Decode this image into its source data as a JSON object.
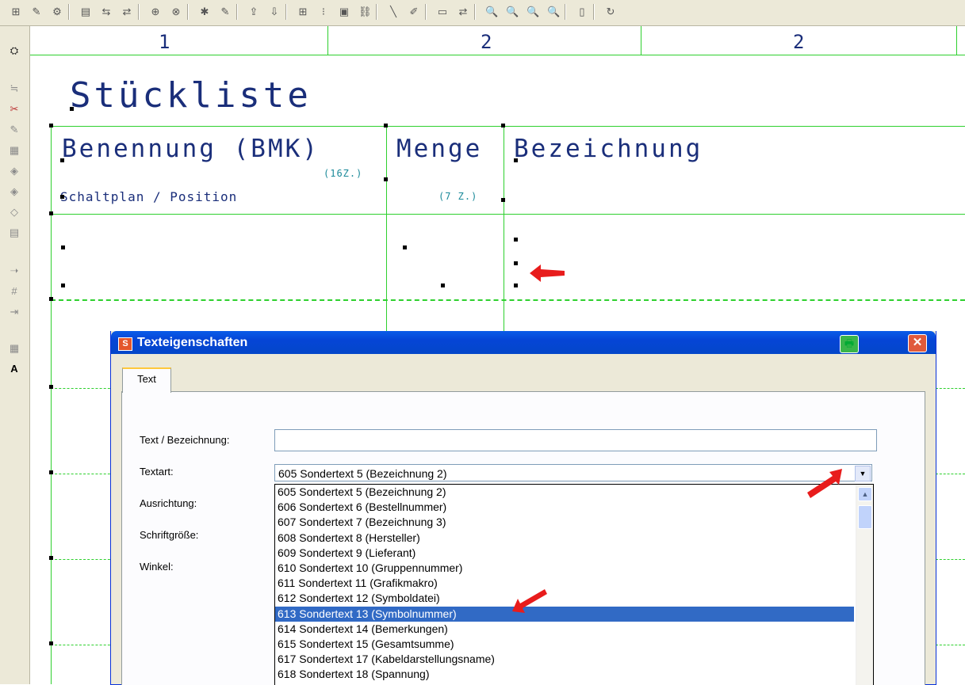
{
  "toolbar": {
    "icons": [
      "select-icon",
      "edit-icon",
      "props-icon",
      "table-icon",
      "split-icon",
      "merge-icon",
      "insert-row-icon",
      "insert-col-icon",
      "macro-icon",
      "macro-edit-icon",
      "export-icon",
      "import-icon",
      "grid-icon",
      "grid-dots-icon",
      "frame-icon",
      "link-icon",
      "line-icon",
      "pen-icon",
      "window-icon",
      "swap-icon",
      "zoom-in-icon",
      "zoom-out-icon",
      "zoom-window-icon",
      "zoom-all-icon",
      "book-icon",
      "refresh-icon"
    ]
  },
  "drawing": {
    "column_numbers": [
      "1",
      "2",
      "2"
    ],
    "title": "Stückliste",
    "col1_header": "Benennung (BMK)",
    "col1_hint": "(16Z.)",
    "col1_sub": "Schaltplan / Position",
    "col2_header": "Menge",
    "col2_hint": "(7 Z.)",
    "col3_header": "Bezeichnung",
    "colors": {
      "lines": "#2ed02e",
      "text": "#1a2e7a",
      "hint_text": "#1b8a9a"
    }
  },
  "dialog": {
    "title": "Texteigenschaften",
    "tab_label": "Text",
    "labels": {
      "text": "Text / Bezeichnung:",
      "textart": "Textart:",
      "ausrichtung": "Ausrichtung:",
      "schriftgroesse": "Schriftgröße:",
      "winkel": "Winkel:"
    },
    "text_value": "",
    "textart_selected": "605 Sondertext 5 (Bezeichnung 2)",
    "options": [
      "605 Sondertext 5 (Bezeichnung 2)",
      "606 Sondertext 6 (Bestellnummer)",
      "607 Sondertext 7 (Bezeichnung 3)",
      "608 Sondertext 8 (Hersteller)",
      "609 Sondertext 9 (Lieferant)",
      "610 Sondertext 10 (Gruppennummer)",
      "611 Sondertext 11 (Grafikmakro)",
      "612 Sondertext 12 (Symboldatei)",
      "613 Sondertext 13 (Symbolnummer)",
      "614 Sondertext 14 (Bemerkungen)",
      "615 Sondertext 15 (Gesamtsumme)",
      "617 Sondertext 17 (Kabeldarstellungsname)",
      "618 Sondertext 18 (Spannung)"
    ],
    "highlighted_option": "613 Sondertext 13 (Symbolnummer)",
    "colors": {
      "titlebar": "#0545d6",
      "highlight": "#316ac5"
    }
  }
}
